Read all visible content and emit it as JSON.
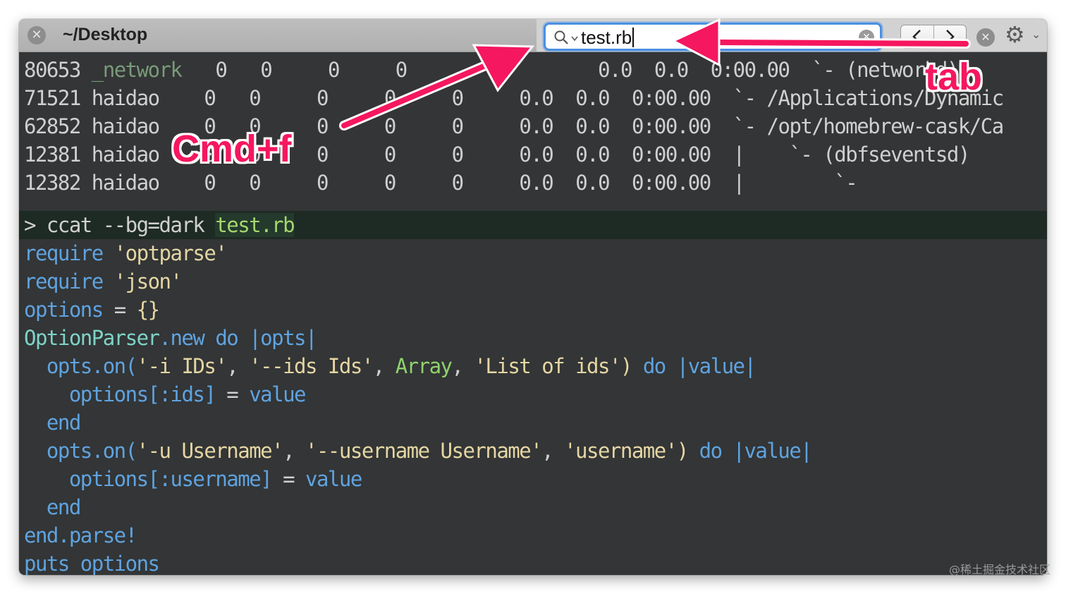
{
  "window": {
    "tab_title": "~/Desktop"
  },
  "find_bar": {
    "search_value": "test.rb",
    "colors": {
      "focus_ring": "#4a90e2"
    }
  },
  "process_rows": [
    {
      "pid": "80653",
      "user": "_network",
      "c1": "0",
      "c2": "0",
      "c3": "0",
      "c4": "0",
      "c5": "",
      "cpu": "0.0",
      "mem": "0.0",
      "time": "0:00.00",
      "tree": "`- (networkd)"
    },
    {
      "pid": "71521",
      "user": "haidao",
      "c1": "0",
      "c2": "0",
      "c3": "0",
      "c4": "0",
      "c5": "0",
      "cpu": "0.0",
      "mem": "0.0",
      "time": "0:00.00",
      "tree": "`- /Applications/Dynamic"
    },
    {
      "pid": "62852",
      "user": "haidao",
      "c1": "0",
      "c2": "0",
      "c3": "0",
      "c4": "0",
      "c5": "0",
      "cpu": "0.0",
      "mem": "0.0",
      "time": "0:00.00",
      "tree": "`- /opt/homebrew-cask/Ca"
    },
    {
      "pid": "12381",
      "user": "haidao",
      "c1": "0",
      "c2": "0",
      "c3": "0",
      "c4": "0",
      "c5": "0",
      "cpu": "0.0",
      "mem": "0.0",
      "time": "0:00.00",
      "tree": "|    `- (dbfseventsd)"
    },
    {
      "pid": "12382",
      "user": "haidao",
      "c1": "0",
      "c2": "0",
      "c3": "0",
      "c4": "0",
      "c5": "0",
      "cpu": "0.0",
      "mem": "0.0",
      "time": "0:00.00",
      "tree": "|        `-"
    }
  ],
  "command": {
    "prompt": "> ",
    "text": "ccat --bg=dark ",
    "highlight": "test.rb"
  },
  "code": {
    "l1": {
      "a": "require ",
      "b": "'optparse'"
    },
    "l2": {
      "a": "require ",
      "b": "'json'"
    },
    "l3": {
      "a": "options ",
      "b": "= ",
      "c": "{}"
    },
    "l4": {
      "a": "OptionParser",
      "b": ".new ",
      "c": "do ",
      "d": "|opts|"
    },
    "l5": {
      "a": "  opts.on(",
      "b": "'-i IDs'",
      "c": ", ",
      "d": "'--ids Ids'",
      "e": ", ",
      "f": "Array",
      "g": ", ",
      "h": "'List of ids'",
      "i": ") ",
      "j": "do ",
      "k": "|value|"
    },
    "l6": {
      "a": "    options",
      "b": "[:ids] ",
      "c": "= ",
      "d": "value"
    },
    "l7": {
      "a": "  end"
    },
    "l8": {
      "a": "  opts.on(",
      "b": "'-u Username'",
      "c": ", ",
      "d": "'--username Username'",
      "e": ", ",
      "f": "'username'",
      "g": ") ",
      "h": "do ",
      "i": "|value|"
    },
    "l9": {
      "a": "    options",
      "b": "[:username] ",
      "c": "= ",
      "d": "value"
    },
    "l10": {
      "a": "  end"
    },
    "l11": {
      "a": "end.parse!"
    },
    "l12": {
      "a": "puts options"
    }
  },
  "annotations": {
    "cmd_f": "Cmd+f",
    "tab": "tab",
    "color": "#f5175f"
  },
  "watermark": "@稀土掘金技术社区"
}
